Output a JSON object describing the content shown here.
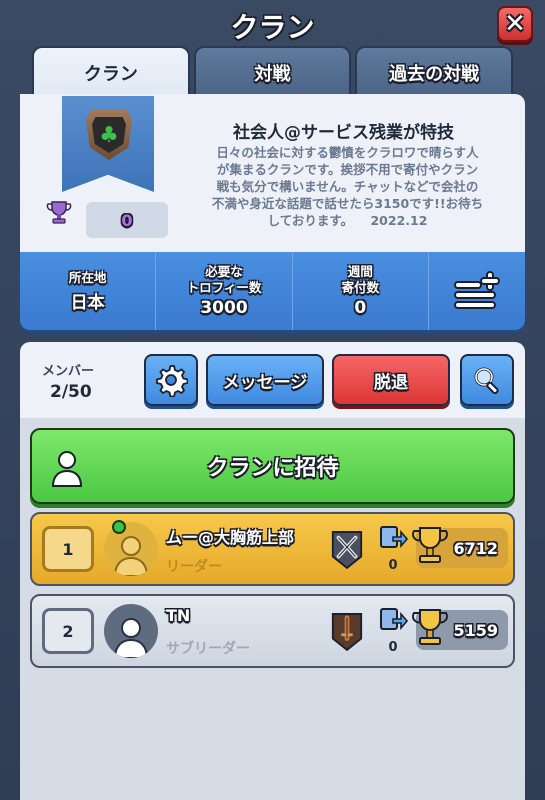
{
  "window": {
    "title": "クラン"
  },
  "tabs": [
    {
      "label": "クラン",
      "active": true
    },
    {
      "label": "対戦",
      "active": false
    },
    {
      "label": "過去の対戦",
      "active": false
    }
  ],
  "clan": {
    "name": "社会人@サービス残業が特技",
    "description_lines": [
      "日々の社会に対する鬱憤をクラロワで晴らす人",
      "が集まるクランです。挨拶不用で寄付やクラン",
      "戦も気分で構いません。チャットなどで会社の",
      "不満や身近な話題で話せたら3150です!!お待ち",
      "しております。    2022.12"
    ],
    "clan_war_trophies": "0",
    "badge_icon": "clover-icon"
  },
  "stats": {
    "location_label": "所在地",
    "location_value": "日本",
    "required_trophies_label_1": "必要な",
    "required_trophies_label_2": "トロフィー数",
    "required_trophies_value": "3000",
    "weekly_donations_label_1": "週間",
    "weekly_donations_label_2": "寄付数",
    "weekly_donations_value": "0",
    "menu_icon": "list-add-icon"
  },
  "members_bar": {
    "label": "メンバー",
    "count": "2/50",
    "settings_icon": "gear-icon",
    "message_label": "メッセージ",
    "leave_label": "脱退",
    "search_icon": "search-icon"
  },
  "invite": {
    "label": "クランに招待",
    "icon": "person-icon"
  },
  "members": [
    {
      "rank": "1",
      "name": "ムー@大胸筋上部",
      "role": "リーダー",
      "online": true,
      "donations": "0",
      "trophies": "6712",
      "arena_icon": "crossed-swords-icon"
    },
    {
      "rank": "2",
      "name": "TN",
      "role": "サブリーダー",
      "online": false,
      "donations": "0",
      "trophies": "5159",
      "arena_icon": "sword-shield-icon"
    }
  ],
  "colors": {
    "accent_blue": "#3a7ad0",
    "green": "#4cc843",
    "red": "#dd3535",
    "gold": "#e6a92a"
  }
}
